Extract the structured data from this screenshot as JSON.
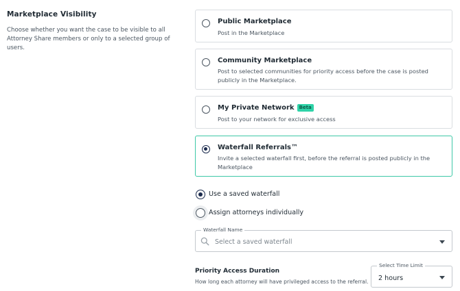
{
  "section": {
    "title": "Marketplace Visibility",
    "description": "Choose whether you want the case to be visible to all Attorney Share members or only to a selected group of users."
  },
  "options": [
    {
      "title": "Public Marketplace",
      "description": "Post in the Marketplace",
      "selected": false
    },
    {
      "title": "Community Marketplace",
      "description": "Post to selected communities for priority access before the case is posted publicly in the Marketplace.",
      "selected": false
    },
    {
      "title": "My Private Network",
      "badge": "Beta",
      "description": "Post to your network for exclusive access",
      "selected": false
    },
    {
      "title": "Waterfall Referrals™",
      "description": "Invite a selected waterfall first, before the referral is posted publicly in the Marketplace",
      "selected": true
    }
  ],
  "waterfall_mode": {
    "saved_label": "Use a saved waterfall",
    "individual_label": "Assign attorneys individually",
    "selected": "saved"
  },
  "waterfall_field": {
    "label": "Waterfall Name",
    "placeholder": "Select a saved waterfall",
    "value": ""
  },
  "priority_access": {
    "title": "Priority Access Duration",
    "description": "How long each attorney will have privileged access to the referral.",
    "time_limit_label": "Select Time Limit",
    "time_limit_value": "2 hours"
  },
  "colors": {
    "selected_border": "#3cc8a6",
    "radio_checked": "#1b2b4d",
    "badge_bg": "#2fd3a8"
  }
}
